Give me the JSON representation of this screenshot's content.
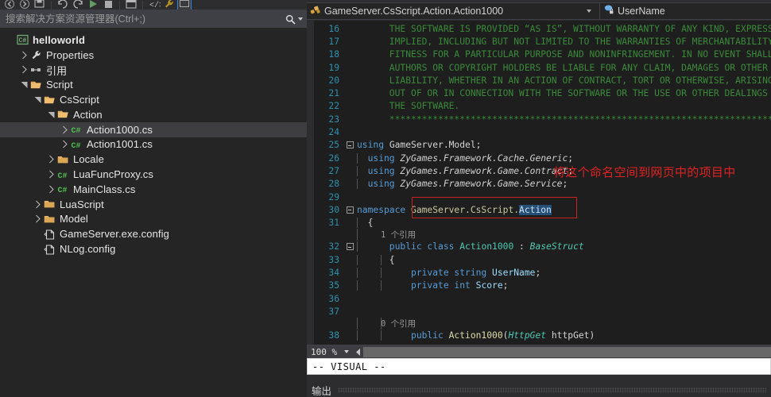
{
  "toolbar": {
    "icons": [
      {
        "name": "navigate-back-icon"
      },
      {
        "name": "navigate-forward-icon"
      },
      {
        "name": "save-all-icon"
      },
      {
        "name": "undo-icon"
      },
      {
        "name": "redo-icon"
      },
      {
        "name": "start-debug-icon"
      },
      {
        "name": "stop-icon"
      },
      {
        "name": "window-layout-icon"
      },
      {
        "name": "attach-process-icon"
      },
      {
        "name": "wrench-icon"
      },
      {
        "name": "panel-toggle-icon"
      }
    ]
  },
  "solution_explorer": {
    "search_placeholder": "搜索解决方案资源管理器(Ctrl+;)",
    "search_value": "",
    "search_icon": "magnifier-icon",
    "search_dropdown_icon": "chevron-down-icon",
    "tree": [
      {
        "label": "helloworld",
        "depth": 0,
        "icon": "csharp-project-icon",
        "twisty": "none",
        "bold": true,
        "selected": false
      },
      {
        "label": "Properties",
        "depth": 1,
        "icon": "wrench-icon",
        "twisty": "collapsed",
        "bold": false,
        "selected": false
      },
      {
        "label": "引用",
        "depth": 1,
        "icon": "references-icon",
        "twisty": "collapsed",
        "bold": false,
        "selected": false
      },
      {
        "label": "Script",
        "depth": 1,
        "icon": "folder-open-icon",
        "twisty": "expanded",
        "bold": false,
        "selected": false
      },
      {
        "label": "CsScript",
        "depth": 2,
        "icon": "folder-open-icon",
        "twisty": "expanded",
        "bold": false,
        "selected": false
      },
      {
        "label": "Action",
        "depth": 3,
        "icon": "folder-open-icon",
        "twisty": "expanded",
        "bold": false,
        "selected": false
      },
      {
        "label": "Action1000.cs",
        "depth": 4,
        "icon": "csharp-file-icon",
        "twisty": "collapsed",
        "bold": false,
        "selected": true
      },
      {
        "label": "Action1001.cs",
        "depth": 4,
        "icon": "csharp-file-icon",
        "twisty": "collapsed",
        "bold": false,
        "selected": false
      },
      {
        "label": "Locale",
        "depth": 3,
        "icon": "folder-closed-icon",
        "twisty": "collapsed",
        "bold": false,
        "selected": false
      },
      {
        "label": "LuaFuncProxy.cs",
        "depth": 3,
        "icon": "csharp-file-icon",
        "twisty": "collapsed",
        "bold": false,
        "selected": false
      },
      {
        "label": "MainClass.cs",
        "depth": 3,
        "icon": "csharp-file-icon",
        "twisty": "collapsed",
        "bold": false,
        "selected": false
      },
      {
        "label": "LuaScript",
        "depth": 2,
        "icon": "folder-closed-icon",
        "twisty": "collapsed",
        "bold": false,
        "selected": false
      },
      {
        "label": "Model",
        "depth": 2,
        "icon": "folder-closed-icon",
        "twisty": "collapsed",
        "bold": false,
        "selected": false
      },
      {
        "label": "GameServer.exe.config",
        "depth": 2,
        "icon": "config-file-icon",
        "twisty": "none",
        "bold": false,
        "selected": false
      },
      {
        "label": "NLog.config",
        "depth": 2,
        "icon": "config-file-icon",
        "twisty": "none",
        "bold": false,
        "selected": false
      }
    ]
  },
  "editor": {
    "breadcrumb": {
      "type_icon": "class-members-icon",
      "type_name": "GameServer.CsScript.Action.Action1000",
      "type_dropdown_icon": "chevron-down-icon",
      "member_icon": "private-field-icon",
      "member_name": "UserName",
      "member_dropdown_icon": "chevron-down-icon"
    },
    "lines": [
      {
        "n": "16",
        "glyph": "",
        "indent_guides": [],
        "tokens": [
          {
            "t": "      THE SOFTWARE IS PROVIDED “AS IS”, WITHOUT WARRANTY OF ANY KIND, EXPRESS OR",
            "c": "cmt"
          }
        ]
      },
      {
        "n": "17",
        "glyph": "",
        "indent_guides": [],
        "tokens": [
          {
            "t": "      IMPLIED, INCLUDING BUT NOT LIMITED TO THE WARRANTIES OF MERCHANTABILITY,",
            "c": "cmt"
          }
        ]
      },
      {
        "n": "18",
        "glyph": "",
        "indent_guides": [],
        "tokens": [
          {
            "t": "      FITNESS FOR A PARTICULAR PURPOSE AND NONINFRINGEMENT. IN NO EVENT SHALL THE",
            "c": "cmt"
          }
        ]
      },
      {
        "n": "19",
        "glyph": "",
        "indent_guides": [],
        "tokens": [
          {
            "t": "      AUTHORS OR COPYRIGHT HOLDERS BE LIABLE FOR ANY CLAIM, DAMAGES OR OTHER",
            "c": "cmt"
          }
        ]
      },
      {
        "n": "20",
        "glyph": "",
        "indent_guides": [],
        "tokens": [
          {
            "t": "      LIABILITY, WHETHER IN AN ACTION OF CONTRACT, TORT OR OTHERWISE, ARISING FROM,",
            "c": "cmt"
          }
        ]
      },
      {
        "n": "21",
        "glyph": "",
        "indent_guides": [],
        "tokens": [
          {
            "t": "      OUT OF OR IN CONNECTION WITH THE SOFTWARE OR THE USE OR OTHER DEALINGS IN",
            "c": "cmt"
          }
        ]
      },
      {
        "n": "22",
        "glyph": "",
        "indent_guides": [],
        "tokens": [
          {
            "t": "      THE SOFTWARE.",
            "c": "cmt"
          }
        ]
      },
      {
        "n": "23",
        "glyph": "",
        "indent_guides": [],
        "tokens": [
          {
            "t": "      *********************************************************************************/",
            "c": "cmt"
          }
        ]
      },
      {
        "n": "24",
        "glyph": "",
        "indent_guides": [],
        "tokens": []
      },
      {
        "n": "25",
        "glyph": "collapse",
        "indent_guides": [],
        "tokens": [
          {
            "t": "using ",
            "c": "kw"
          },
          {
            "t": "GameServer.Model;",
            "c": "pl"
          }
        ]
      },
      {
        "n": "26",
        "glyph": "",
        "indent_guides": [
          0
        ],
        "tokens": [
          {
            "t": "  using ",
            "c": "kw"
          },
          {
            "t": "ZyGames.Framework.Cache.Generic",
            "c": "ns-italic"
          },
          {
            "t": ";",
            "c": "pl"
          }
        ]
      },
      {
        "n": "27",
        "glyph": "",
        "indent_guides": [
          0
        ],
        "tokens": [
          {
            "t": "  using ",
            "c": "kw"
          },
          {
            "t": "ZyGames.Framework.Game.Contract",
            "c": "ns-italic"
          },
          {
            "t": ";",
            "c": "pl"
          }
        ]
      },
      {
        "n": "28",
        "glyph": "",
        "indent_guides": [
          0
        ],
        "tokens": [
          {
            "t": "  using ",
            "c": "kw"
          },
          {
            "t": "ZyGames.Framework.Game.Service",
            "c": "ns-italic"
          },
          {
            "t": ";",
            "c": "pl"
          }
        ]
      },
      {
        "n": "29",
        "glyph": "",
        "indent_guides": [],
        "tokens": []
      },
      {
        "n": "30",
        "glyph": "collapse",
        "indent_guides": [],
        "tokens": [
          {
            "t": "namespace ",
            "c": "kw"
          },
          {
            "t": "GameServer.CsScript.",
            "c": "ns"
          },
          {
            "t": "Action",
            "c": "sel-text"
          }
        ]
      },
      {
        "n": "31",
        "glyph": "",
        "indent_guides": [
          0
        ],
        "tokens": [
          {
            "t": "  {",
            "c": "pl"
          }
        ]
      },
      {
        "n": "",
        "glyph": "",
        "indent_guides": [
          0
        ],
        "refs": "1 个引用"
      },
      {
        "n": "32",
        "glyph": "collapse",
        "indent_guides": [
          0
        ],
        "tokens": [
          {
            "t": "      public class ",
            "c": "kw"
          },
          {
            "t": "Action1000",
            "c": "typ"
          },
          {
            "t": " : ",
            "c": "pl"
          },
          {
            "t": "BaseStruct",
            "c": "typ-i"
          }
        ]
      },
      {
        "n": "33",
        "glyph": "",
        "indent_guides": [
          0,
          1
        ],
        "tokens": [
          {
            "t": "      {",
            "c": "pl"
          }
        ]
      },
      {
        "n": "34",
        "glyph": "",
        "indent_guides": [
          0,
          1
        ],
        "tokens": [
          {
            "t": "          private string ",
            "c": "kw"
          },
          {
            "t": "UserName",
            "c": "fld"
          },
          {
            "t": ";",
            "c": "pl"
          }
        ]
      },
      {
        "n": "35",
        "glyph": "",
        "indent_guides": [
          0,
          1
        ],
        "tokens": [
          {
            "t": "          private int ",
            "c": "kw"
          },
          {
            "t": "Score",
            "c": "fld"
          },
          {
            "t": ";",
            "c": "pl"
          }
        ]
      },
      {
        "n": "36",
        "glyph": "",
        "indent_guides": [
          0,
          1
        ],
        "tokens": []
      },
      {
        "n": "37",
        "glyph": "",
        "indent_guides": [
          0,
          1
        ],
        "tokens": []
      },
      {
        "n": "",
        "glyph": "",
        "indent_guides": [
          0,
          1
        ],
        "refs": "0 个引用"
      },
      {
        "n": "38",
        "glyph": "",
        "indent_guides": [
          0,
          1
        ],
        "tokens": [
          {
            "t": "          public ",
            "c": "kw"
          },
          {
            "t": "Action1000",
            "c": "id"
          },
          {
            "t": "(",
            "c": "pl"
          },
          {
            "t": "HttpGet",
            "c": "typ-i"
          },
          {
            "t": " httpGet)",
            "c": "pl"
          }
        ]
      }
    ],
    "annotation": {
      "text": "将这个命名空间到网页中的项目中",
      "color": "#e02222"
    },
    "highlight_box_color": "#cc2222",
    "zoom_level": "100 %",
    "zoom_dropdown_icon": "chevron-down-icon",
    "hscroll_left_icon": "scroll-left-arrow-icon"
  },
  "vim_status": {
    "mode_text": "-- VISUAL --"
  },
  "output_panel": {
    "title": "输出"
  },
  "colors": {
    "accent_blue": "#3399ff",
    "selection_blue": "#264f78",
    "linenum_blue": "#2b91af",
    "comment_green": "#3a8a3a",
    "keyword_blue": "#569cd6",
    "type_teal": "#4ec9b0",
    "namespace_gold": "#c8c8a0",
    "field_lightblue": "#9cdcfe",
    "annotation_red": "#e02222"
  }
}
